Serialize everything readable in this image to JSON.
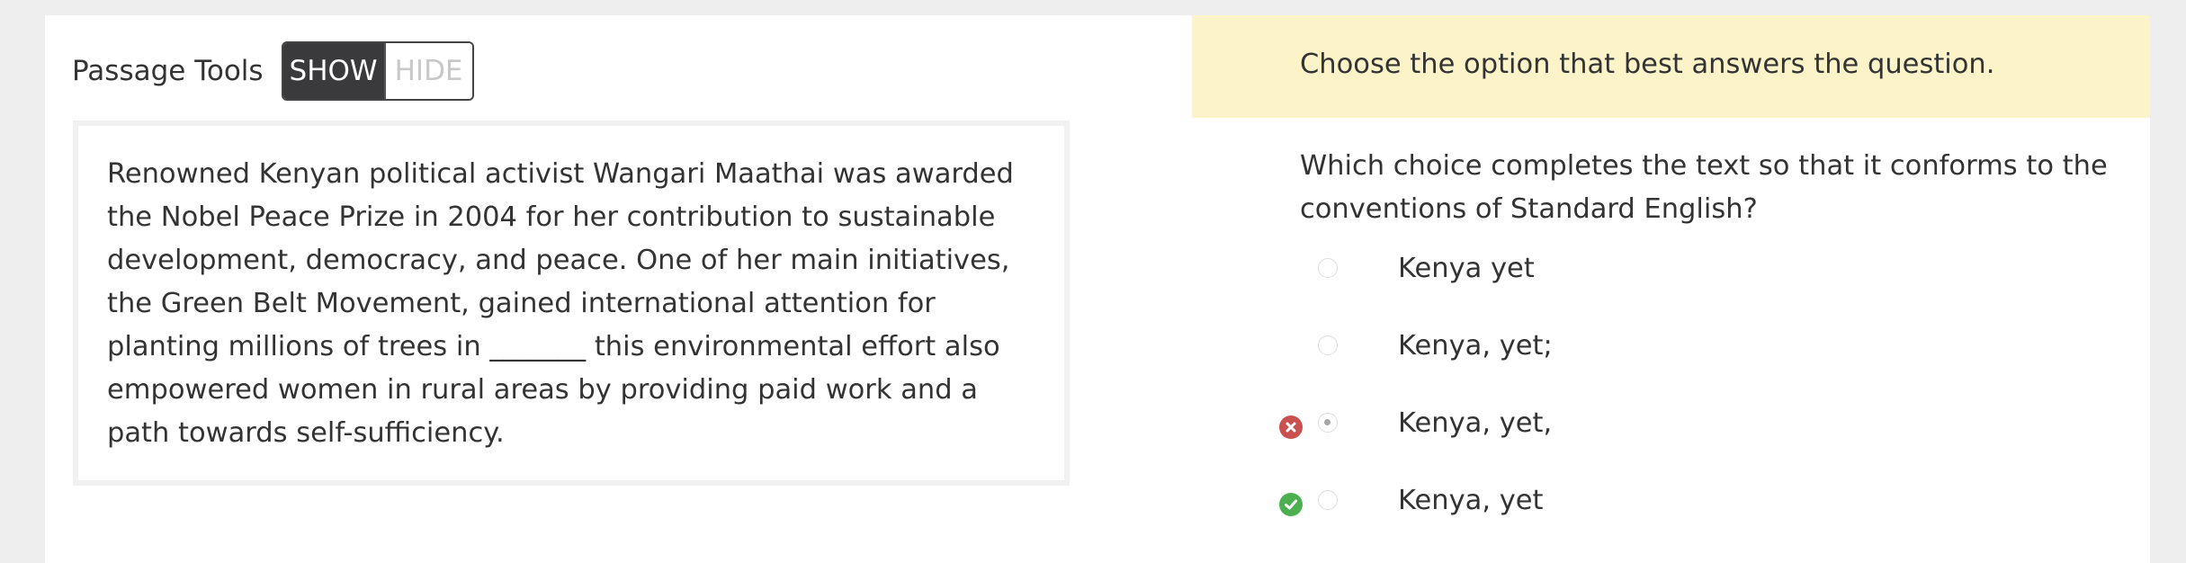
{
  "passage_tools": {
    "label": "Passage Tools",
    "show_label": "SHOW",
    "hide_label": "HIDE"
  },
  "passage": {
    "text": "Renowned Kenyan political activist Wangari Maathai was awarded the Nobel Peace Prize in 2004 for her contribution to sustainable development, democracy, and peace. One of her main initiatives, the Green Belt Movement, gained international attention for planting millions of trees in _______ this environmental effort also empowered women in rural areas by providing paid work and a path towards self-sufficiency."
  },
  "instruction": {
    "text": "Choose the option that best answers the question."
  },
  "question": {
    "text": "Which choice completes the text so that it conforms to the conventions of Standard English?"
  },
  "options": [
    {
      "label": "Kenya yet",
      "selected": false,
      "status": ""
    },
    {
      "label": "Kenya, yet;",
      "selected": false,
      "status": ""
    },
    {
      "label": "Kenya, yet,",
      "selected": true,
      "status": "incorrect"
    },
    {
      "label": "Kenya, yet",
      "selected": false,
      "status": "correct"
    }
  ],
  "colors": {
    "instruction_background": "#fcf3c9",
    "toggle_active": "#3a3a3c",
    "incorrect": "#c9514f",
    "correct": "#4caf50"
  }
}
